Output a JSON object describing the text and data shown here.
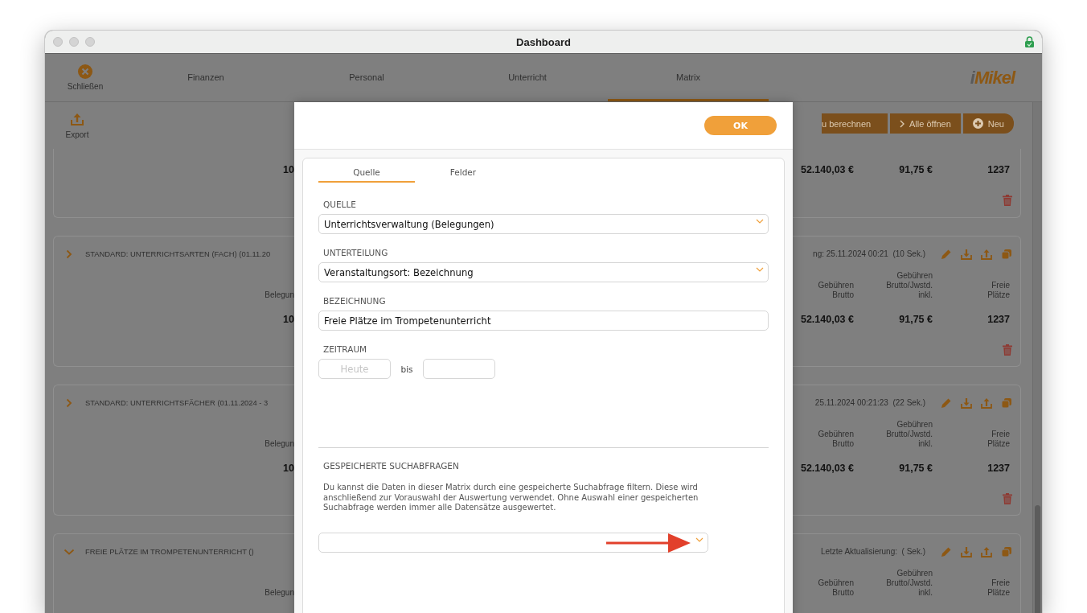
{
  "window": {
    "title": "Dashboard"
  },
  "header": {
    "close_label": "Schließen",
    "tabs": [
      {
        "label": "Finanzen",
        "selected": false
      },
      {
        "label": "Personal",
        "selected": false
      },
      {
        "label": "Unterricht",
        "selected": false
      },
      {
        "label": "Matrix",
        "selected": true
      }
    ],
    "logo": {
      "prefix": "i",
      "name": "Mikel"
    }
  },
  "toolbar": {
    "export_label": "Export",
    "buttons": [
      {
        "kind": "plain",
        "label": "u berechnen"
      },
      {
        "kind": "chevron",
        "label": "Alle öffnen"
      },
      {
        "kind": "plus",
        "label": "Neu"
      }
    ]
  },
  "cards": [
    {
      "left_value": "10",
      "values": [
        "52.140,03 €",
        "91,75 €",
        "1237"
      ]
    },
    {
      "title": "STANDARD: UNTERRICHTSARTEN (FACH) (01.11.20",
      "expanded": false,
      "meta": "ng: 25.11.2024 00:21  (10 Sek.)",
      "left_column": "Belegun",
      "columns": [
        "Gebühren Brutto",
        "Gebühren Brutto/Jwstd. inkl.",
        "Freie Plätze"
      ],
      "left_value": "10",
      "values": [
        "52.140,03 €",
        "91,75 €",
        "1237"
      ]
    },
    {
      "title": "STANDARD: UNTERRICHTSFÄCHER (01.11.2024 - 3",
      "expanded": false,
      "meta": "25.11.2024 00:21:23  (22 Sek.)",
      "left_column": "Belegun",
      "columns": [
        "Gebühren Brutto",
        "Gebühren Brutto/Jwstd. inkl.",
        "Freie Plätze"
      ],
      "left_value": "10",
      "values": [
        "52.140,03 €",
        "91,75 €",
        "1237"
      ]
    },
    {
      "title": "FREIE PLÄTZE IM TROMPETENUNTERRICHT ()",
      "expanded": true,
      "meta": "Letzte Aktualisierung:  ( Sek.)",
      "left_column": "Belegun",
      "columns": [
        "Gebühren Brutto",
        "Gebühren Brutto/Jwstd. inkl.",
        "Freie Plätze"
      ]
    }
  ],
  "dialog": {
    "ok_button": "OK",
    "tabs": [
      {
        "label": "Quelle",
        "selected": true
      },
      {
        "label": "Felder",
        "selected": false
      }
    ],
    "fields": [
      {
        "kind": "select",
        "label": "QUELLE",
        "value": "Unterrichtsverwaltung (Belegungen)"
      },
      {
        "kind": "select",
        "label": "UNTERTEILUNG",
        "value": "Veranstaltungsort: Bezeichnung"
      },
      {
        "kind": "text",
        "label": "BEZEICHNUNG",
        "value": "Freie Plätze im Trompetenunterricht"
      },
      {
        "kind": "range",
        "label": "ZEITRAUM",
        "from_placeholder": "Heute",
        "separator": "bis"
      }
    ],
    "saved_queries": {
      "heading": "GESPEICHERTE SUCHABFRAGEN",
      "description": "Du kannst die Daten in dieser Matrix durch eine gespeicherte Suchabfrage filtern. Diese wird anschließend zur Vorauswahl der Auswertung verwendet. Ohne Auswahl einer gespeicherten Suchabfrage werden immer alle Datensätze ausgewertet."
    }
  }
}
